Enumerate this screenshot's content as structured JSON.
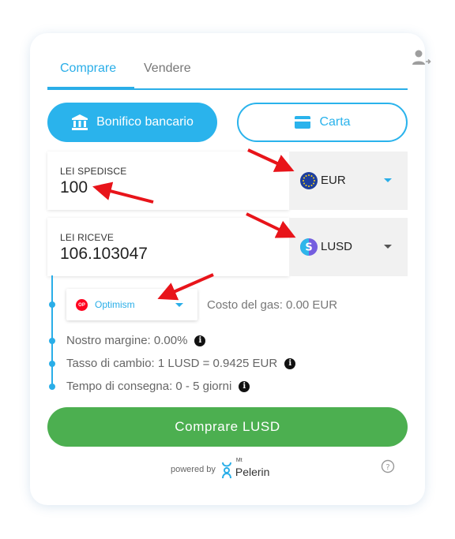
{
  "tabs": [
    {
      "label": "Comprare",
      "active": true
    },
    {
      "label": "Vendere",
      "active": false
    }
  ],
  "payment_methods": {
    "bank_label": "Bonifico bancario",
    "card_label": "Carta"
  },
  "send": {
    "label": "LEI SPEDISCE",
    "value": "100",
    "currency": "EUR",
    "currency_icon": "euro-flag-icon"
  },
  "receive": {
    "label": "LEI RICEVE",
    "value": "106.103047",
    "currency": "LUSD",
    "currency_icon": "lusd-token-icon"
  },
  "network": {
    "badge": "OP",
    "name": "Optimism",
    "gas_text": "Costo del gas: 0.00 EUR"
  },
  "details": {
    "margin": "Nostro margine: 0.00%",
    "rate": "Tasso di cambio: 1 LUSD = 0.9425 EUR",
    "delivery": "Tempo di consegna: 0 - 5 giorni"
  },
  "buy_button": "Comprare LUSD",
  "footer": {
    "powered_by": "powered by",
    "brand_prefix": "Mt",
    "brand_name": "Pelerin"
  },
  "colors": {
    "accent": "#2aaee8",
    "buy": "#4caf50",
    "annotation_arrow": "#e8141a"
  }
}
